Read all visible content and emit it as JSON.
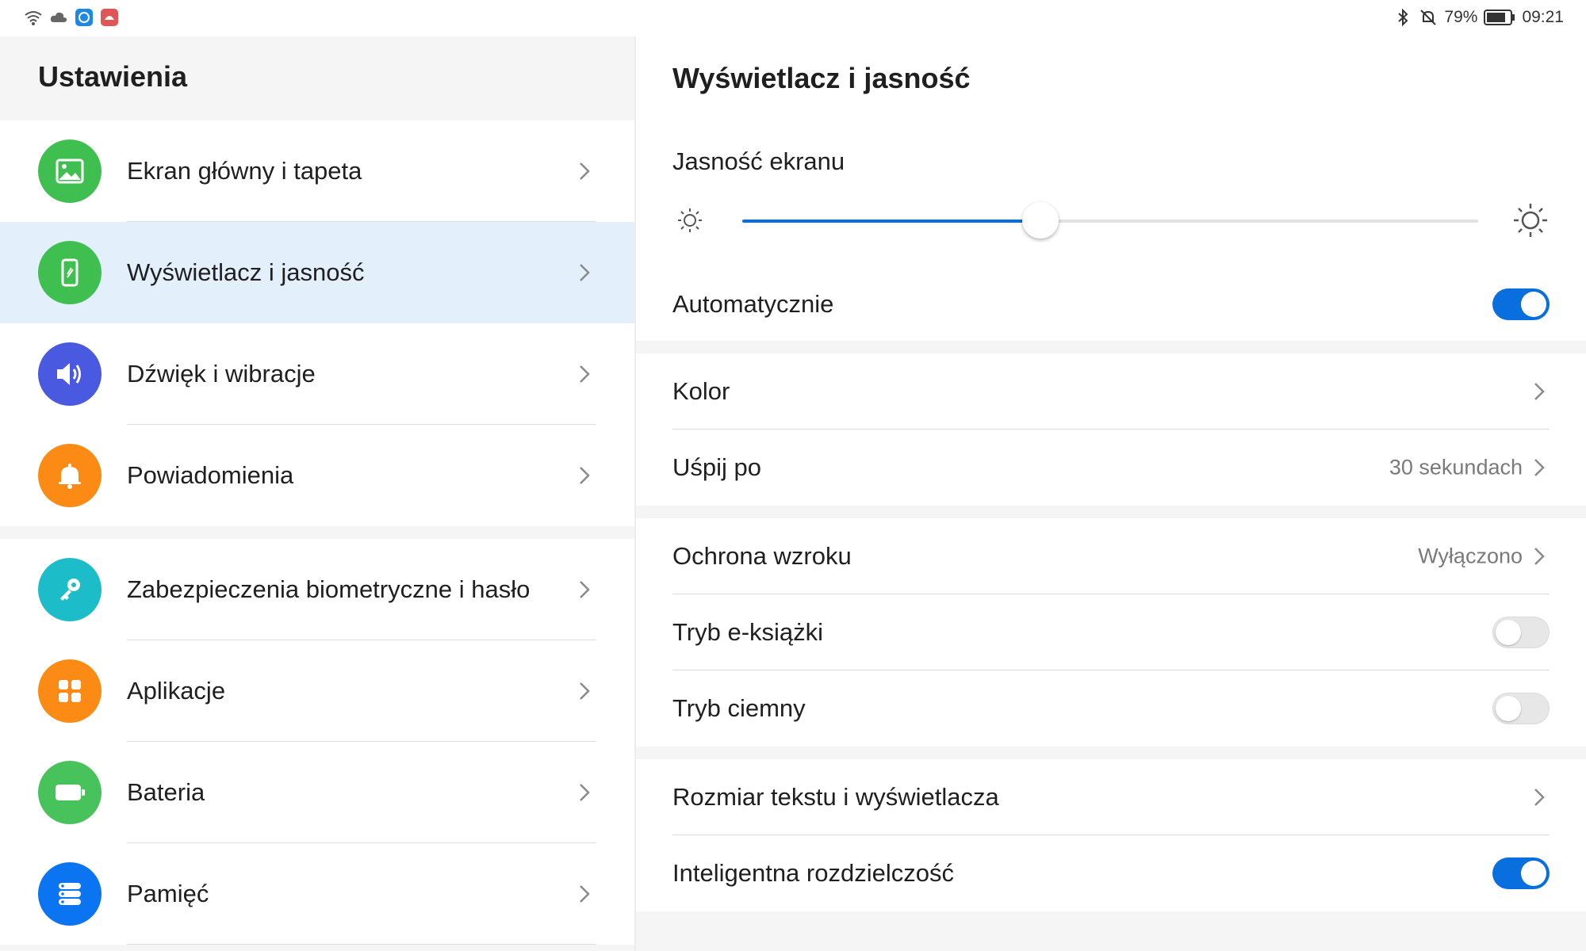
{
  "status_bar": {
    "battery_percent": "79%",
    "time": "09:21"
  },
  "left_panel": {
    "title": "Ustawienia",
    "groups": [
      {
        "items": [
          {
            "label": "Ekran główny i tapeta",
            "icon": "image-icon",
            "color": "#3fbf4f"
          },
          {
            "label": "Wyświetlacz i jasność",
            "icon": "phone-display-icon",
            "color": "#3fbf4f",
            "selected": true
          }
        ]
      },
      {
        "items": [
          {
            "label": "Dźwięk i wibracje",
            "icon": "speaker-icon",
            "color": "#4a5ae0"
          },
          {
            "label": "Powiadomienia",
            "icon": "bell-icon",
            "color": "#fb8b14"
          }
        ]
      },
      {
        "items": [
          {
            "label": "Zabezpieczenia biometryczne i hasło",
            "icon": "key-icon",
            "color": "#1cbdc8"
          },
          {
            "label": "Aplikacje",
            "icon": "apps-grid-icon",
            "color": "#fb8b14"
          },
          {
            "label": "Bateria",
            "icon": "battery-icon",
            "color": "#48c35b"
          },
          {
            "label": "Pamięć",
            "icon": "storage-icon",
            "color": "#0b74f0"
          }
        ]
      }
    ]
  },
  "right_panel": {
    "title": "Wyświetlacz i jasność",
    "brightness": {
      "label": "Jasność ekranu",
      "level": 0.405
    },
    "auto": {
      "label": "Automatycznie",
      "on": true
    },
    "color_row": {
      "label": "Kolor"
    },
    "sleep_row": {
      "label": "Uśpij po",
      "value": "30 sekundach"
    },
    "eye_row": {
      "label": "Ochrona wzroku",
      "value": "Wyłączono"
    },
    "ebook_row": {
      "label": "Tryb e-książki",
      "on": false
    },
    "dark_row": {
      "label": "Tryb ciemny",
      "on": false
    },
    "text_size_row": {
      "label": "Rozmiar tekstu i wyświetlacza"
    },
    "smart_res_row": {
      "label": "Inteligentna rozdzielczość",
      "on": true
    }
  },
  "colors": {
    "accent": "#0a6fde",
    "selected_bg": "#e3f0fc"
  }
}
